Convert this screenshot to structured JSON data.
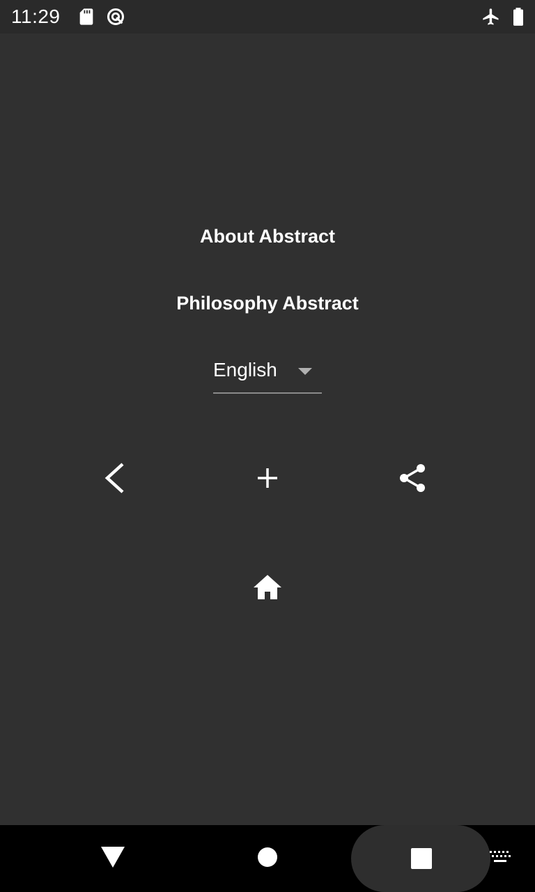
{
  "status_bar": {
    "time": "11:29",
    "icons": [
      "sd-card-icon",
      "sync-icon",
      "airplane-mode-icon",
      "battery-icon"
    ]
  },
  "main": {
    "about_label": "About Abstract",
    "philosophy_label": "Philosophy Abstract",
    "language_select": {
      "selected": "English"
    },
    "actions": [
      "back-icon",
      "add-icon",
      "share-icon"
    ],
    "home": "home-icon"
  },
  "nav_bar": {
    "buttons": [
      "back",
      "home",
      "recents",
      "keyboard"
    ]
  },
  "colors": {
    "background": "#303030",
    "status_bar": "#2a2a2a",
    "nav_bar": "#000000",
    "text": "#ffffff",
    "underline": "#8a8a8a"
  }
}
